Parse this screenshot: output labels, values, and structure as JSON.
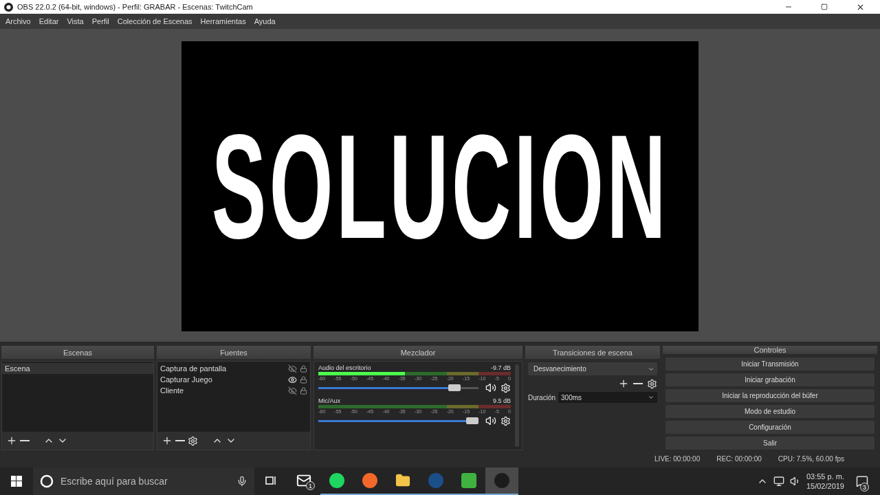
{
  "window": {
    "title": "OBS 22.0.2 (64-bit, windows) - Perfil: GRABAR - Escenas: TwitchCam"
  },
  "menu": [
    "Archivo",
    "Editar",
    "Vista",
    "Perfil",
    "Colección de Escenas",
    "Herramientas",
    "Ayuda"
  ],
  "preview": {
    "overlay_text": "SOLUCION"
  },
  "scenes": {
    "title": "Escenas",
    "items": [
      {
        "label": "Escena",
        "selected": true
      }
    ]
  },
  "sources": {
    "title": "Fuentes",
    "items": [
      {
        "label": "Captura de pantalla",
        "visible": false
      },
      {
        "label": "Capturar Juego",
        "visible": true
      },
      {
        "label": "Cliente",
        "visible": false
      }
    ]
  },
  "mixer": {
    "title": "Mezclador",
    "channels": [
      {
        "name": "Audio del escritorio",
        "reading": "-9.7 dB",
        "meter": {
          "level": 0.45
        },
        "volume": {
          "level": 0.88
        },
        "ticks": [
          "-60",
          "-55",
          "-50",
          "-45",
          "-40",
          "-35",
          "-30",
          "-25",
          "-20",
          "-15",
          "-10",
          "-5",
          "0"
        ]
      },
      {
        "name": "Mic/Aux",
        "reading": "9.5 dB",
        "volume": {
          "level": 1
        },
        "ticks": [
          "-60",
          "-55",
          "-50",
          "-45",
          "-40",
          "-35",
          "-30",
          "-25",
          "-20",
          "-15",
          "-10",
          "-5",
          "0"
        ]
      }
    ]
  },
  "transitions": {
    "title": "Transiciones de escena",
    "selected": "Desvanecimiento",
    "duration_label": "Duración",
    "duration": "300ms"
  },
  "controls": {
    "title": "Controles",
    "buttons": [
      "Iniciar Transmisión",
      "Iniciar grabación",
      "Iniciar la reproducción del búfer",
      "Modo de estudio",
      "Configuración",
      "Salir"
    ]
  },
  "status": {
    "live": "LIVE: 00:00:00",
    "rec": "REC: 00:00:00",
    "cpu": "CPU: 7.5%, 60.00 fps"
  },
  "taskbar": {
    "search_placeholder": "Escribe aquí para buscar",
    "apps": [
      {
        "kind": "mail",
        "running": false,
        "selected": false,
        "badge": "1"
      },
      {
        "kind": "spotify",
        "running": true,
        "selected": false
      },
      {
        "kind": "firefox",
        "running": true,
        "selected": false
      },
      {
        "kind": "folder",
        "running": true,
        "selected": false
      },
      {
        "kind": "steam",
        "running": true,
        "selected": false
      },
      {
        "kind": "camtasia",
        "running": true,
        "selected": false
      },
      {
        "kind": "obs",
        "running": true,
        "selected": true
      }
    ],
    "clock": {
      "time": "03:55 p. m.",
      "date": "15/02/2019"
    },
    "notifications": "3"
  }
}
